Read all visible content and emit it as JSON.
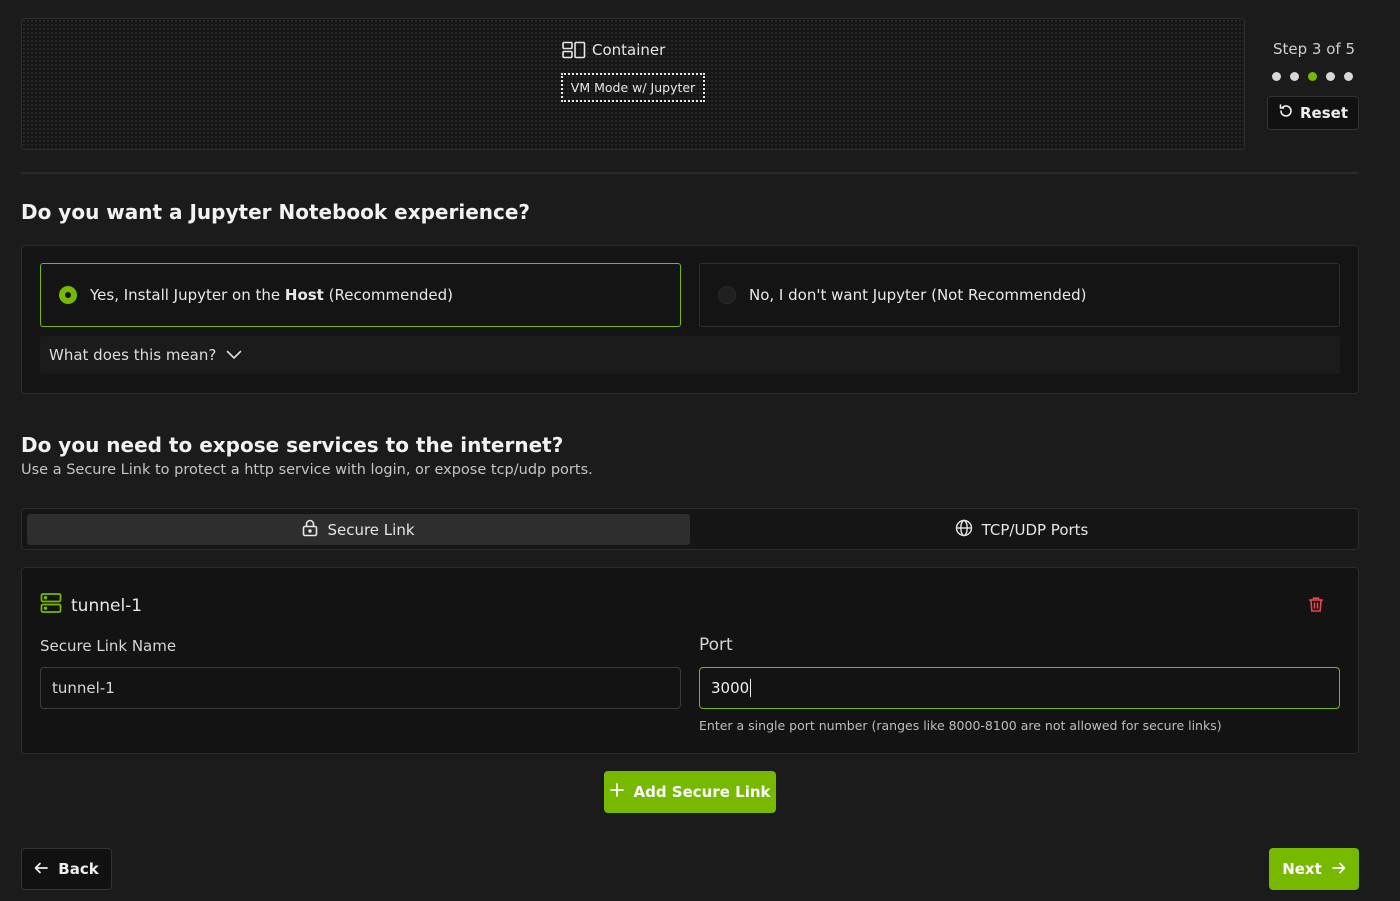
{
  "preview": {
    "container_label": "Container",
    "mode_tag": "VM Mode w/ Jupyter"
  },
  "stepper": {
    "label": "Step 3 of 5",
    "total_steps": 5,
    "current_step": 3,
    "active_color": "#76b900",
    "reset_label": "Reset"
  },
  "jupyter": {
    "heading": "Do you want a Jupyter Notebook experience?",
    "option_yes": {
      "prefix": "Yes, Install Jupyter on the ",
      "bold": "Host",
      "suffix": " (Recommended)",
      "selected": true
    },
    "option_no": {
      "label": "No, I don't want Jupyter (Not Recommended)",
      "selected": false
    },
    "help_label": "What does this mean?"
  },
  "expose": {
    "heading": "Do you need to expose services to the internet?",
    "subtitle": "Use a Secure Link to protect a http service with login, or expose tcp/udp ports.",
    "tabs": [
      {
        "label": "Secure Link",
        "icon": "lock-icon",
        "active": true
      },
      {
        "label": "TCP/UDP Ports",
        "icon": "globe-icon",
        "active": false
      }
    ],
    "link": {
      "title": "tunnel-1",
      "name_label": "Secure Link Name",
      "name_value": "tunnel-1",
      "port_label": "Port",
      "port_value": "3000",
      "port_hint": "Enter a single port number (ranges like 8000-8100 are not allowed for secure links)"
    },
    "add_label": "Add Secure Link"
  },
  "footer": {
    "back_label": "Back",
    "next_label": "Next"
  },
  "colors": {
    "accent": "#76b900",
    "danger": "#e5484d",
    "background": "#1b1b1b"
  }
}
